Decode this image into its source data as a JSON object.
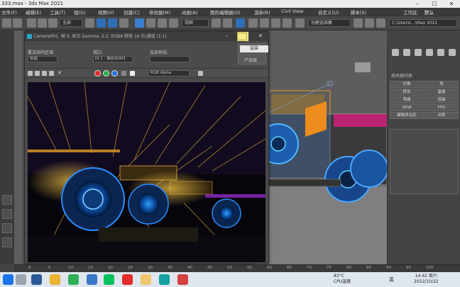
{
  "window": {
    "title": "333.max - 3ds Max 2021",
    "minimize_glyph": "–",
    "maximize_glyph": "☐",
    "close_glyph": "✕"
  },
  "menu": {
    "items": [
      "文件(F)",
      "编辑(E)",
      "工具(T)",
      "组(G)",
      "视图(V)",
      "创建(C)",
      "修改器(M)",
      "动画(A)",
      "图形编辑器(D)",
      "渲染(R)",
      "Civil View",
      "自定义(U)",
      "脚本(S)",
      "工作区:",
      "默认"
    ]
  },
  "toolbar": {
    "selection_filter": "全部",
    "reference_coord": "视图",
    "named_selection": "创建选择集",
    "path": "C:\\Users\\...\\Max 2021"
  },
  "render_window": {
    "title": "Camera001, 帧 0, 显示 Gamma: 2.2, RGBA 颜色 16 位/通道 (1:1)",
    "area_label": "要渲染的区域",
    "area_value": "视图",
    "viewport_label": "视口:",
    "viewport_value": "四 1 - 摄影机001",
    "preset_label": "渲染预设:",
    "preset_value": "",
    "render_button_label": "渲染",
    "product_level_label": "产品级",
    "channel_value": "RGB Alpha",
    "swatch_colors": [
      "#e02626",
      "#21b34a",
      "#2277dd"
    ]
  },
  "tooltip": {
    "text": "渲染"
  },
  "command_panel": {
    "section_title": "修改器列表",
    "buttons": [
      "切角",
      "壳",
      "挤出",
      "晶格",
      "弯曲",
      "扭曲",
      "UVW",
      "FFD",
      "编辑多边形",
      "对称"
    ]
  },
  "timeline": {
    "ticks": [
      "0",
      "5",
      "10",
      "15",
      "20",
      "25",
      "30",
      "35",
      "40",
      "45",
      "50",
      "55",
      "60",
      "65",
      "70",
      "75",
      "80",
      "85",
      "90",
      "95",
      "100"
    ]
  },
  "taskbar": {
    "temperature": "83°C",
    "temp_caption": "CPU温度",
    "lang": "英",
    "time": "14:42 周六",
    "date": "2022/10/22"
  },
  "colors": {
    "accent_orange": "#f2a21c",
    "accent_blue": "#1f8fff",
    "viewport_gray": "#5d5d5d"
  }
}
